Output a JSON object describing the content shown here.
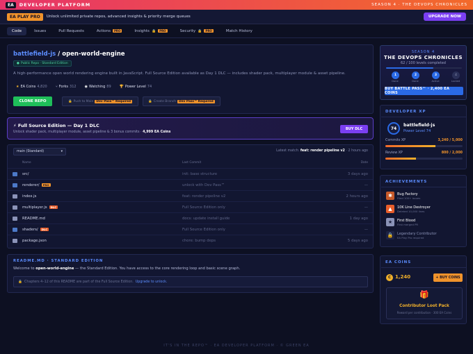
{
  "topbar": {
    "logo": "EA",
    "title": "DEVELOPER PLATFORM",
    "season": "SEASON 4 · THE DEVOPS CHRONICLES"
  },
  "promo": {
    "tag": "EA PLAY PRO",
    "text": "Unlock unlimited private repos, advanced insights & priority merge queues",
    "button": "UPGRADE NOW"
  },
  "nav": {
    "tabs": [
      {
        "label": "Code",
        "active": true
      },
      {
        "label": "Issues"
      },
      {
        "label": "Pull Requests"
      },
      {
        "label": "Actions",
        "badge": "PRO"
      },
      {
        "label": "Insights",
        "badge": "PRO",
        "locked": true
      },
      {
        "label": "Security",
        "badge": "PRO",
        "locked": true
      },
      {
        "label": "Match History"
      }
    ]
  },
  "repo": {
    "owner": "battlefield-js",
    "separator": " / ",
    "name": "open-world-engine",
    "visibility": "Public Repo · Standard Edition",
    "description": "A high-performance open world rendering engine built in JavaScript. Full Source Edition available as Day 1 DLC — includes shader pack, multiplayer module & asset pipeline.",
    "stats": [
      {
        "icon": "star-icon",
        "label": "EA Coins",
        "value": "4,820"
      },
      {
        "icon": "fork-icon",
        "label": "Forks",
        "value": "312"
      },
      {
        "icon": "eye-icon",
        "label": "Watching",
        "value": "89"
      },
      {
        "icon": "trophy-icon",
        "label": "Power Level",
        "value": "74"
      }
    ],
    "clone_button": "CLONE REPO",
    "push_button": "Push to Main",
    "branch_button": "Create Branch",
    "dev_pass": "Dev Pass™ Required"
  },
  "dlc": {
    "title": "⚡ Full Source Edition — Day 1 DLC",
    "sub": "Unlock shader pack, multiplayer module, asset pipeline & 3 bonus commits ·",
    "price": "4,999 EA Coins",
    "button": "BUY DLC"
  },
  "files": {
    "branch": "main (Standard)",
    "latest_prefix": "Latest match:",
    "latest_commit": "feat: render pipeline v2",
    "latest_time": "· 2 hours ago",
    "headers": {
      "name": "Name",
      "commit": "Last Commit",
      "date": "Date"
    },
    "rows": [
      {
        "name": "src/",
        "type": "folder",
        "commit": "init: base structure",
        "date": "3 days ago"
      },
      {
        "name": "renderer/",
        "type": "folder",
        "tag": "PRO",
        "commit": "unlock with Dev Pass™",
        "date": "—"
      },
      {
        "name": "index.js",
        "type": "file",
        "commit": "feat: render pipeline v2",
        "date": "2 hours ago"
      },
      {
        "name": "multiplayer.js",
        "type": "file",
        "tag": "DLC",
        "commit": "Full Source Edition only",
        "date": "—"
      },
      {
        "name": "README.md",
        "type": "file",
        "commit": "docs: update install guide",
        "date": "1 day ago"
      },
      {
        "name": "shaders/",
        "type": "folder",
        "tag": "DLC",
        "commit": "Full Source Edition only",
        "date": "—"
      },
      {
        "name": "package.json",
        "type": "file",
        "commit": "chore: bump deps",
        "date": "5 days ago"
      }
    ]
  },
  "readme": {
    "title": "README.MD · STANDARD EDITION",
    "text_prefix": "Welcome to",
    "text_bold": "open-world-engine",
    "text_suffix": "— the Standard Edition. You have access to the core rendering loop and basic scene graph.",
    "locked_text": "Chapters 4–12 of this README are part of the Full Source Edition.",
    "locked_link": "Upgrade to unlock."
  },
  "footer": "IT'S IN THE REPO™ · EA DEVELOPER PLATFORM · © GREEN EA",
  "season": {
    "label": "SEASON 4",
    "title": "THE DEVOPS CHRONICLES",
    "progress": "62 / 100 levels completed",
    "progress_fraction": 0.62,
    "tiers": [
      {
        "num": "1",
        "label": "Done",
        "color": "#2a6ae6"
      },
      {
        "num": "2",
        "label": "Done",
        "color": "#2a6ae6"
      },
      {
        "num": "3",
        "label": "Active",
        "color": "#2a6ae6"
      },
      {
        "num": "4",
        "label": "Locked",
        "color": "#2a3058"
      }
    ],
    "button": "BUY BATTLE PASS™ · 2,400 EA COINS"
  },
  "xp": {
    "title": "DEVELOPER XP",
    "level_num": "74",
    "name": "battlefield-js",
    "level": "Power Level 74",
    "rows": [
      {
        "label": "Commits XP",
        "value": "3,240 / 5,000",
        "fraction": 0.648
      },
      {
        "label": "Review XP",
        "value": "800 / 2,000",
        "fraction": 0.4
      }
    ]
  },
  "achievements": {
    "title": "ACHIEVEMENTS",
    "items": [
      {
        "name": "Bug Factory",
        "desc": "Filed 100+ issues",
        "icon": "bug-icon",
        "color": "#c75a2a"
      },
      {
        "name": "10K Line Destroyer",
        "desc": "Deleted 10,000 lines",
        "icon": "flame-icon",
        "color": "#e85d2a"
      },
      {
        "name": "First Blood",
        "desc": "First merged PR",
        "icon": "star-icon",
        "color": "#8b93b8"
      },
      {
        "name": "Legendary Contributor",
        "desc": "EA Play Pro required",
        "icon": "lock-icon",
        "color": "#2a3058"
      }
    ]
  },
  "coins": {
    "title": "EA COINS",
    "symbol": "C",
    "amount": "1,240",
    "button": "+ BUY COINS",
    "loot_title": "Contributor Loot Pack",
    "loot_sub": "Reward per contribution · 300 EA Coins"
  }
}
